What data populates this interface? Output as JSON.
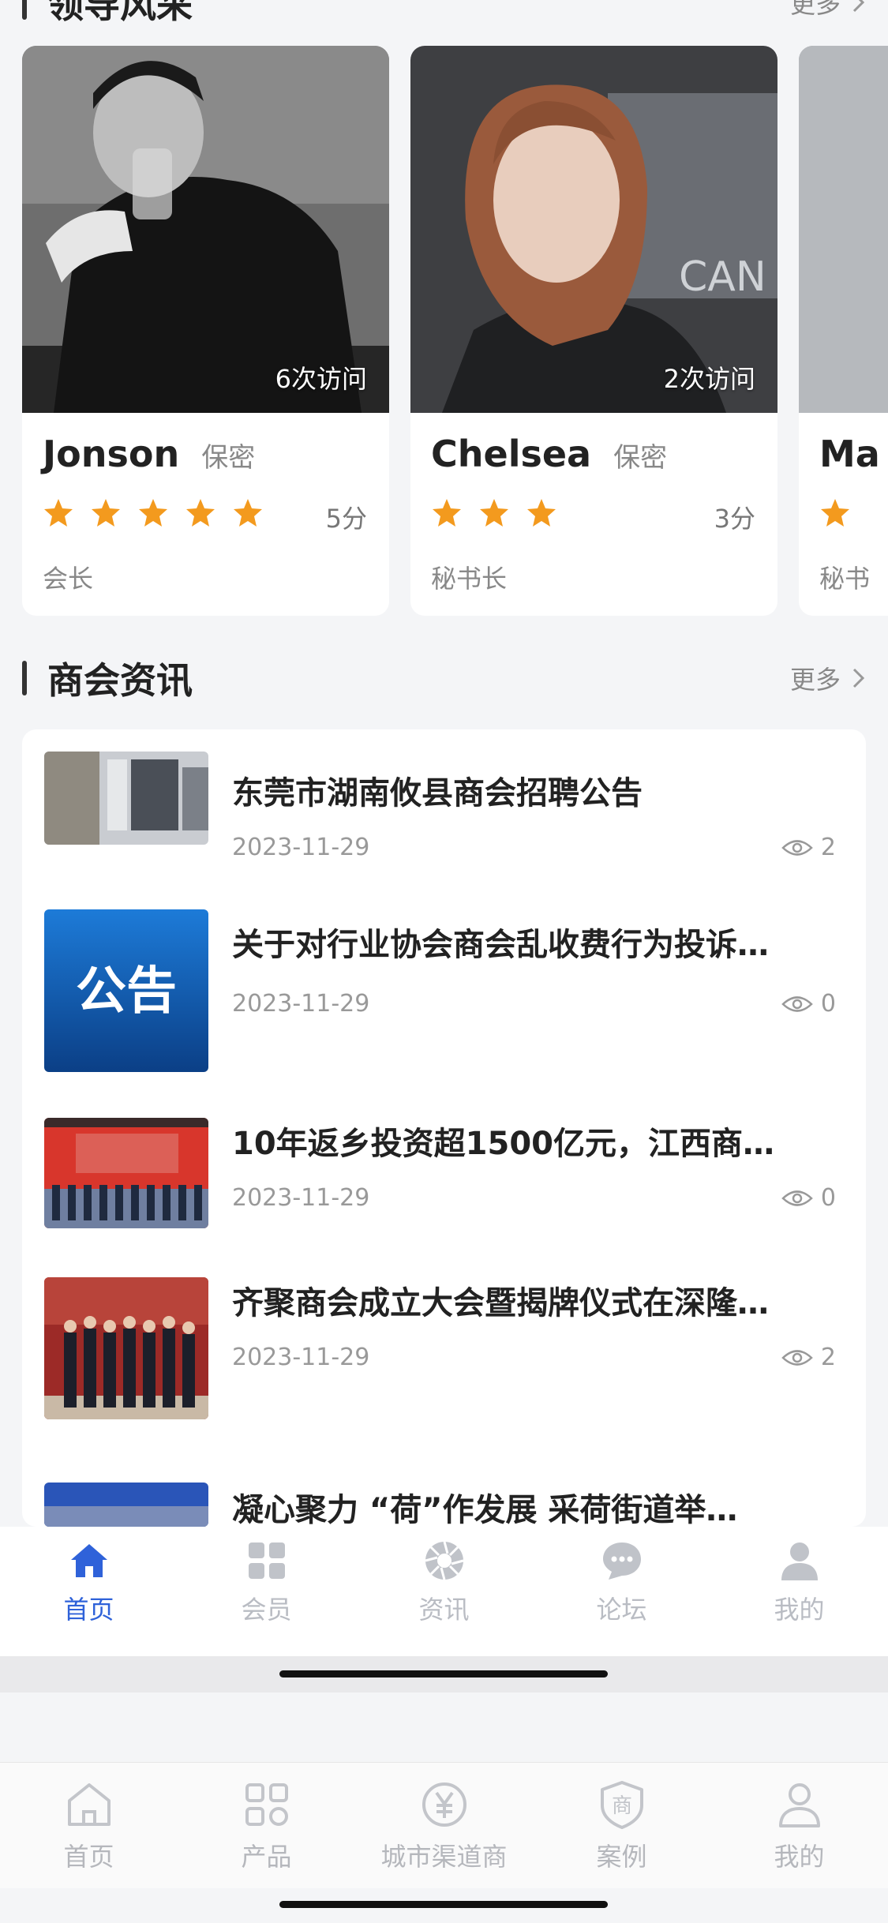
{
  "leaders_section": {
    "title": "领导风采",
    "more": "更多"
  },
  "leaders": [
    {
      "name": "Jonson",
      "gender": "保密",
      "visits": "6次访问",
      "rating": 5,
      "score": "5分",
      "role": "会长"
    },
    {
      "name": "Chelsea",
      "gender": "保密",
      "visits": "2次访问",
      "rating": 3,
      "score": "3分",
      "role": "秘书长"
    },
    {
      "name": "Ma",
      "gender": "",
      "visits": "",
      "rating": 1,
      "score": "",
      "role": "秘书"
    }
  ],
  "news_section": {
    "title": "商会资讯",
    "more": "更多"
  },
  "news": [
    {
      "title": "东莞市湖南攸县商会招聘公告",
      "date": "2023-11-29",
      "views": "2",
      "thumb_label": ""
    },
    {
      "title": "关于对行业协会商会乱收费行为投诉…",
      "date": "2023-11-29",
      "views": "0",
      "thumb_label": "公告"
    },
    {
      "title": "10年返乡投资超1500亿元，江西商…",
      "date": "2023-11-29",
      "views": "0",
      "thumb_label": ""
    },
    {
      "title": "齐聚商会成立大会暨揭牌仪式在深隆…",
      "date": "2023-11-29",
      "views": "2",
      "thumb_label": ""
    },
    {
      "title": "凝心聚力 “荷”作发展 采荷街道举…",
      "date": "",
      "views": "",
      "thumb_label": ""
    }
  ],
  "tabbar_primary": [
    {
      "label": "首页",
      "icon": "home-icon",
      "active": true
    },
    {
      "label": "会员",
      "icon": "grid-icon",
      "active": false
    },
    {
      "label": "资讯",
      "icon": "aperture-icon",
      "active": false
    },
    {
      "label": "论坛",
      "icon": "chat-icon",
      "active": false
    },
    {
      "label": "我的",
      "icon": "user-icon",
      "active": false
    }
  ],
  "tabbar_secondary": [
    {
      "label": "首页",
      "icon": "home-outline-icon"
    },
    {
      "label": "产品",
      "icon": "apps-outline-icon"
    },
    {
      "label": "城市渠道商",
      "icon": "yuan-outline-icon"
    },
    {
      "label": "案例",
      "icon": "shield-shang-icon"
    },
    {
      "label": "我的",
      "icon": "user-outline-icon"
    }
  ],
  "colors": {
    "accent": "#2f62d9",
    "star": "#f39a1e",
    "inactive": "#b9bcc3"
  }
}
